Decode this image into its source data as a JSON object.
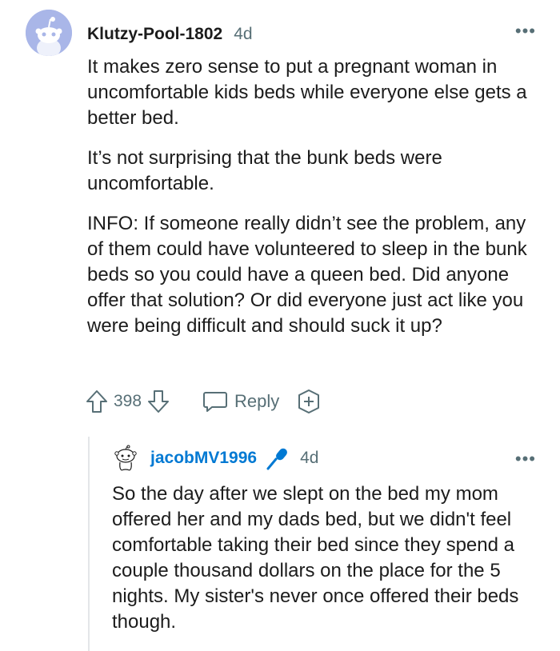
{
  "comment": {
    "author": "Klutzy-Pool-1802",
    "time": "4d",
    "more_label": "•••",
    "paragraphs": [
      "It makes zero sense to put a pregnant woman in uncomfortable kids beds while everyone else gets a better bed.",
      "It’s not surprising that the bunk beds were uncomfortable.",
      "INFO: If someone really didn’t see the problem, any of them could have volunteered to sleep in the bunk beds so you could have a queen bed. Did anyone offer that solution? Or did everyone just act like you were being difficult and should suck it up?"
    ],
    "score": "398",
    "reply_label": "Reply",
    "icons": {
      "avatar": "reddit-snoo-avatar-icon",
      "upvote": "upvote-arrow-icon",
      "downvote": "downvote-arrow-icon",
      "reply": "speech-bubble-icon",
      "award": "award-plus-icon",
      "more": "more-dots-icon"
    }
  },
  "reply": {
    "author": "jacobMV1996",
    "time": "4d",
    "more_label": "•••",
    "body": "So the day after we slept on the bed my mom offered her and my dads bed, but we didn't feel comfortable taking their bed since they spend a couple thousand dollars on the place for the 5 nights. My sister's never once offered their beds though.",
    "icons": {
      "avatar": "snoo-outline-avatar-icon",
      "op_badge": "microphone-icon"
    }
  },
  "colors": {
    "author_link": "#0079d3",
    "meta": "#576f76",
    "text": "#1c1c1c",
    "avatar_bg": "#a9b6e8",
    "thread_line": "#e4e6e8"
  }
}
